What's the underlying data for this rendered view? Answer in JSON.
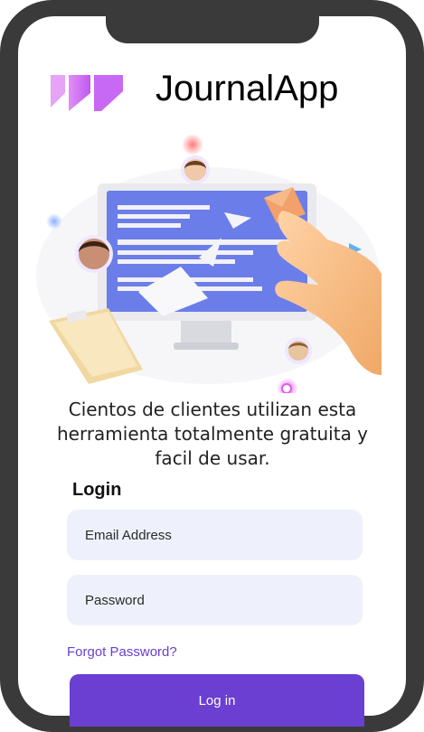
{
  "brand": {
    "app_name": "JournalApp",
    "logo_icon": "journalapp-logo-icon",
    "logo_color": "#c869f5"
  },
  "illustration": {
    "description_icons": [
      "monitor-icon",
      "hand-icon",
      "avatar-icon",
      "clipboard-icon",
      "paper-plane-icon",
      "envelope-icon"
    ]
  },
  "tagline": "Cientos de clientes utilizan esta herramienta totalmente gratuita y facil de usar.",
  "login": {
    "heading": "Login",
    "email_placeholder": "Email Address",
    "password_placeholder": "Password",
    "forgot_label": "Forgot Password?",
    "button_label": "Log in"
  },
  "colors": {
    "accent": "#6a3fd2",
    "field_bg": "#eef1fb",
    "frame": "#3a3a3a"
  }
}
